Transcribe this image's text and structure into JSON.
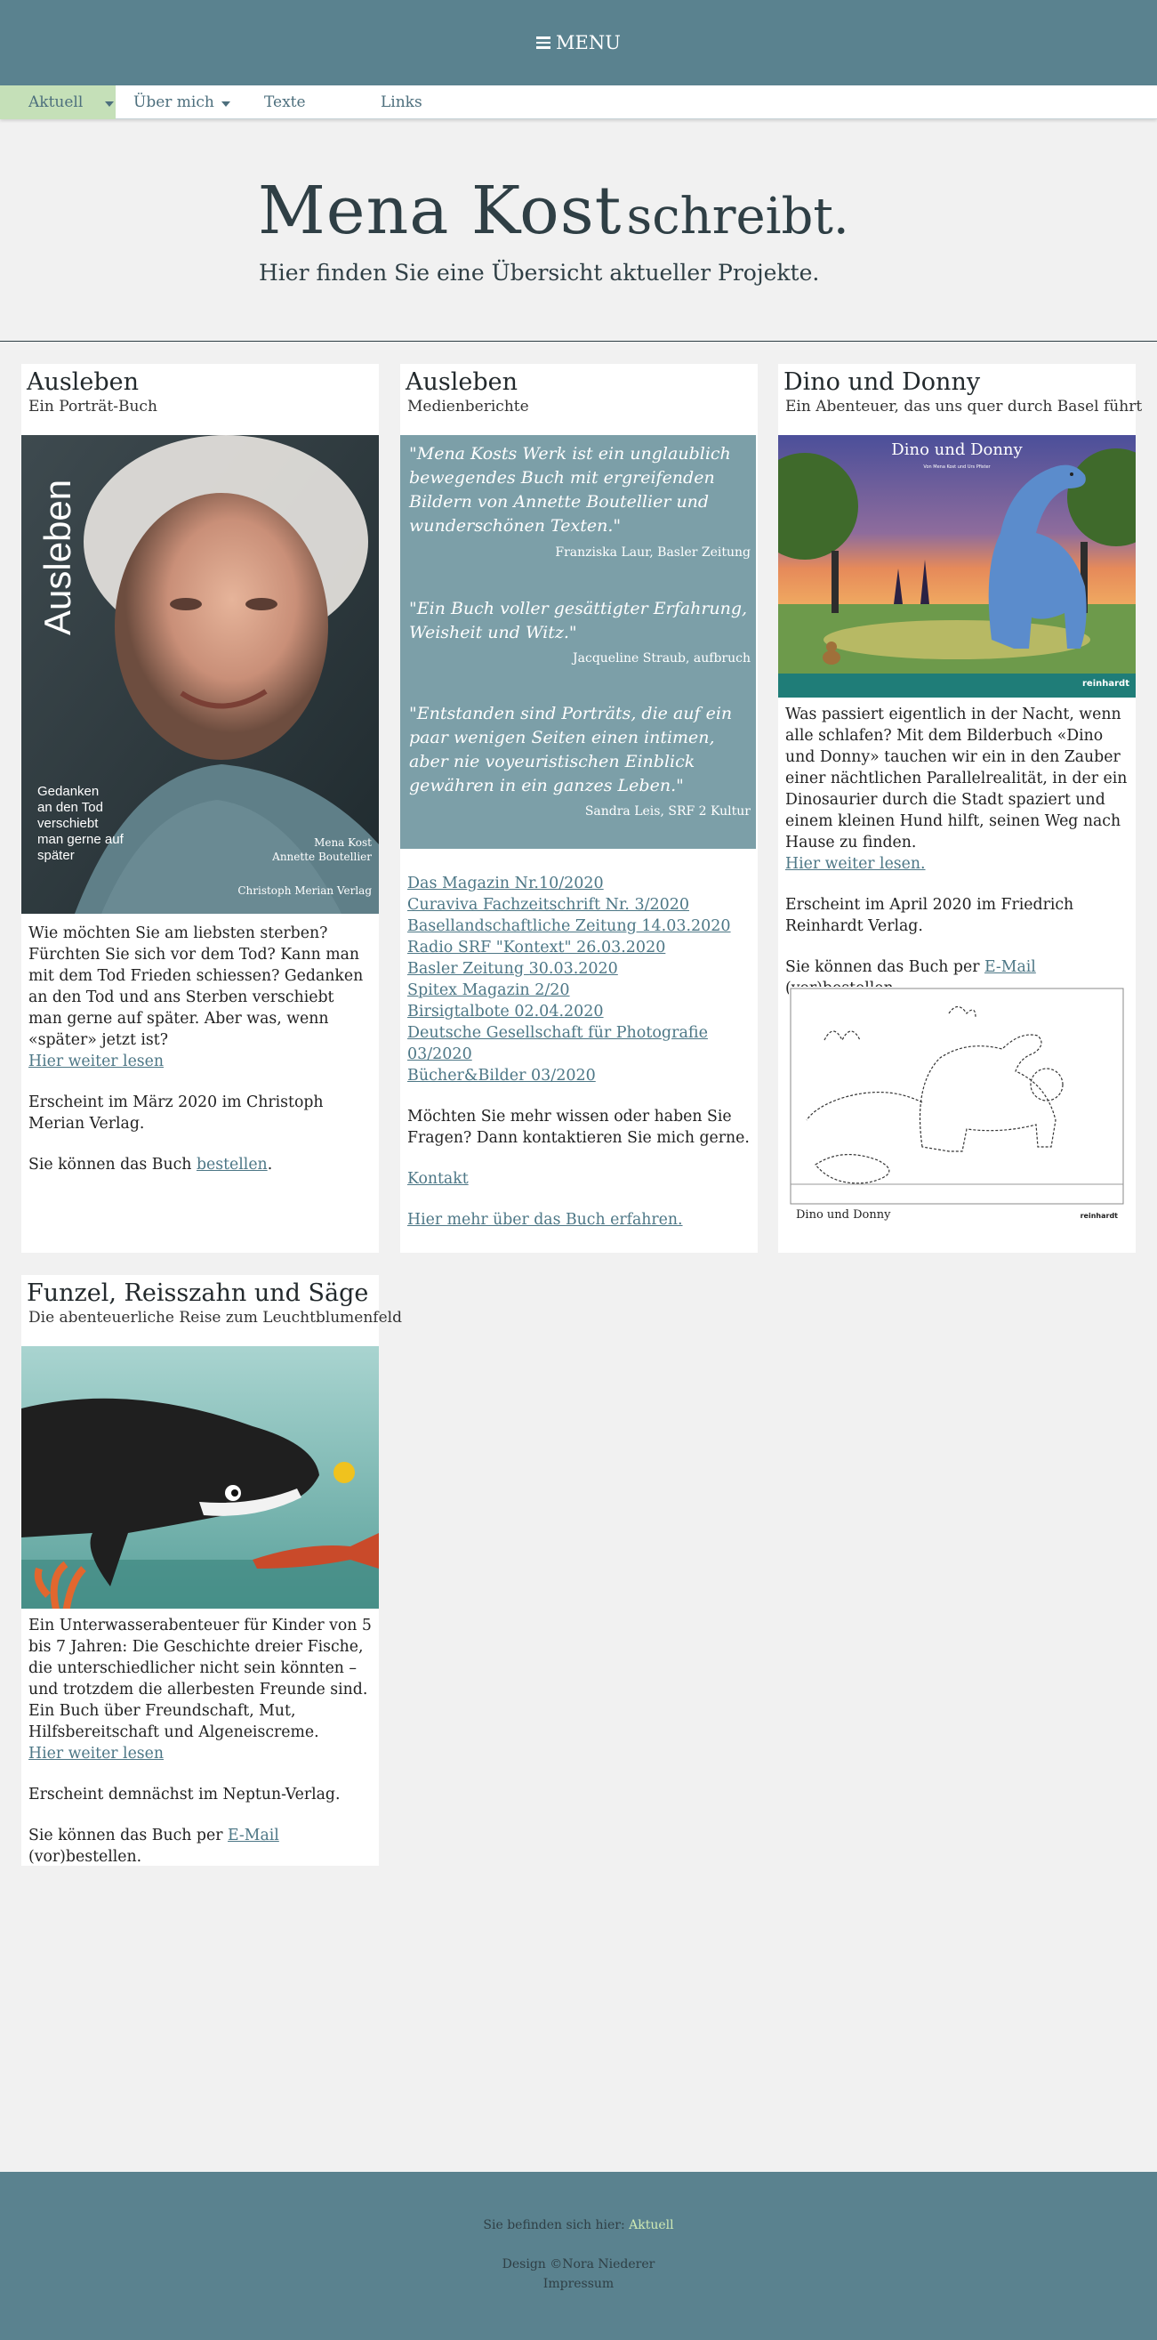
{
  "header": {
    "menu_label": "MENU"
  },
  "nav": {
    "items": [
      {
        "label": "Aktuell"
      },
      {
        "label": "Über mich"
      },
      {
        "label": "Texte"
      },
      {
        "label": "Links"
      }
    ]
  },
  "hero": {
    "title_main": "Mena Kost",
    "title_suffix": "schreibt.",
    "subtitle": "Hier finden Sie eine Übersicht aktueller Projekte."
  },
  "cards": [
    {
      "title": "Ausleben",
      "subtitle": "Ein Porträt-Buch",
      "cover": {
        "title": "Ausleben",
        "tagline": [
          "Gedanken",
          "an den Tod",
          "verschiebt",
          "man gerne auf",
          "später"
        ],
        "authors": [
          "Mena Kost",
          "Annette Boutellier"
        ],
        "publisher": "Christoph Merian Verlag"
      },
      "text": "Wie möchten Sie am liebsten sterben? Fürchten Sie sich vor dem Tod? Kann man mit dem Tod Frieden schiessen? Gedanken an den Tod und ans Sterben verschiebt man gerne auf später. Aber was, wenn «später» jetzt ist?",
      "read_more": "Hier weiter lesen",
      "release": "Erscheint im März 2020 im Christoph Merian Verlag.",
      "order_prefix": "Sie können das Buch",
      "order_link": "bestellen",
      "order_suffix": "."
    },
    {
      "title": "Ausleben",
      "subtitle": "Medienberichte",
      "quotes": [
        {
          "text": "\"Mena Kosts Werk ist ein unglaublich bewegendes Buch mit ergreifenden Bildern von Annette Boutellier und wunderschönen Texten.\"",
          "source": "Franziska Laur, Basler Zeitung"
        },
        {
          "text": "\"Ein Buch voller gesättigter Erfahrung, Weisheit und Witz.\"",
          "source": "Jacqueline Straub, aufbruch"
        },
        {
          "text": "\"Entstanden sind Porträts, die auf ein paar wenigen Seiten einen intimen, aber nie voyeuristischen Einblick gewähren in ein ganzes Leben.\"",
          "source": "Sandra Leis, SRF 2 Kultur"
        }
      ],
      "media_links": [
        "Das Magazin Nr.10/2020",
        "Curaviva Fachzeitschrift Nr. 3/2020",
        "Basellandschaftliche Zeitung 14.03.2020",
        "Radio SRF \"Kontext\" 26.03.2020",
        "Basler Zeitung 30.03.2020",
        "Spitex Magazin 2/20",
        "Birsigtalbote 02.04.2020",
        "Deutsche Gesellschaft für Photografie 03/2020",
        "Bücher&Bilder 03/2020"
      ],
      "contact_text": "Möchten Sie mehr wissen oder haben Sie Fragen? Dann kontaktieren Sie mich gerne.",
      "contact_link": "Kontakt",
      "more_link": "Hier mehr über das Buch erfahren."
    },
    {
      "title": "Dino und Donny",
      "subtitle": "Ein Abenteuer, das uns quer durch Basel führt",
      "cover": {
        "title": "Dino und Donny",
        "byline": "Von Mena Kost und Urs Pfister",
        "publisher": "reinhardt"
      },
      "text": "Was passiert eigentlich in der Nacht, wenn alle schlafen? Mit dem Bilderbuch «Dino und Donny» tauchen wir ein in den Zauber einer nächtlichen Parallelrealität, in der ein Dinosaurier durch die Stadt spaziert und einem kleinen Hund hilft, seinen Weg nach Hause zu finden.",
      "read_more": "Hier weiter lesen.",
      "release": "Erscheint im April 2020 im Friedrich Reinhardt Verlag.",
      "order_prefix": "Sie können das Buch per",
      "order_link": "E-Mail",
      "order_suffix": "(vor)bestellen.",
      "sketch": {
        "title": "Dino und Donny",
        "publisher": "reinhardt"
      }
    },
    {
      "title": "Funzel, Reisszahn und Säge",
      "subtitle": "Die abenteuerliche Reise zum Leuchtblumenfeld",
      "text": "Ein Unterwasserabenteuer für Kinder von 5 bis 7 Jahren: Die Geschichte dreier Fische, die unterschiedlicher nicht sein könnten – und trotzdem die allerbesten Freunde sind. Ein Buch über Freundschaft, Mut, Hilfsbereitschaft und Algeneiscreme.",
      "read_more": "Hier weiter lesen",
      "release": "Erscheint demnächst im Neptun-Verlag.",
      "order_prefix": "Sie können das Buch per",
      "order_link": "E-Mail",
      "order_suffix": "(vor)bestellen."
    }
  ],
  "footer": {
    "location_prefix": "Sie befinden sich hier:",
    "location_current": "Aktuell",
    "design": "Design ©Nora Niederer",
    "impressum": "Impressum"
  },
  "colors": {
    "header_bg": "#5a828f",
    "nav_active": "#c5e0b8",
    "quote_bg": "#7c9fa8",
    "link": "#4d7786",
    "page_bg": "#f1f1f1"
  }
}
